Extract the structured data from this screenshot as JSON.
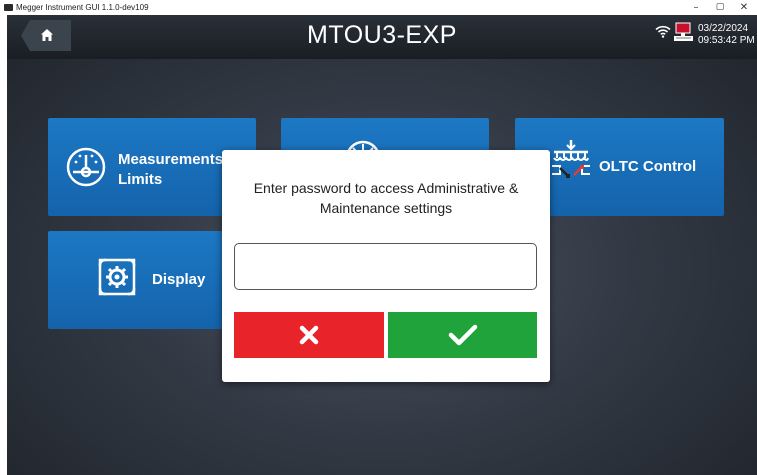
{
  "window": {
    "title": "Megger Instrument GUI 1.1.0-dev109",
    "minimize_glyph": "–",
    "restore_glyph": "▢",
    "close_glyph": "✕"
  },
  "header": {
    "title": "MTOU3-EXP",
    "date": "03/22/2024",
    "time": "09:53:42 PM",
    "icons": [
      "home-icon",
      "wifi-icon",
      "network-icon"
    ]
  },
  "tiles": {
    "measurements": {
      "label_line1": "Measurements",
      "label_line2": "Limits",
      "icon": "gauge-icon"
    },
    "middle": {
      "icon": "gauge-wheel-icon"
    },
    "oltc": {
      "label": "OLTC Control",
      "icon": "oltc-icon"
    },
    "display": {
      "label": "Display",
      "icon": "display-settings-icon"
    }
  },
  "dialog": {
    "message": "Enter password to access Administrative & Maintenance settings",
    "password_value": "",
    "cancel_icon": "x-icon",
    "confirm_icon": "checkmark-icon"
  },
  "colors": {
    "tile_blue": "#1b72bd",
    "cancel_red": "#e8242a",
    "confirm_green": "#20a33a",
    "header_dark": "#1f242b"
  }
}
